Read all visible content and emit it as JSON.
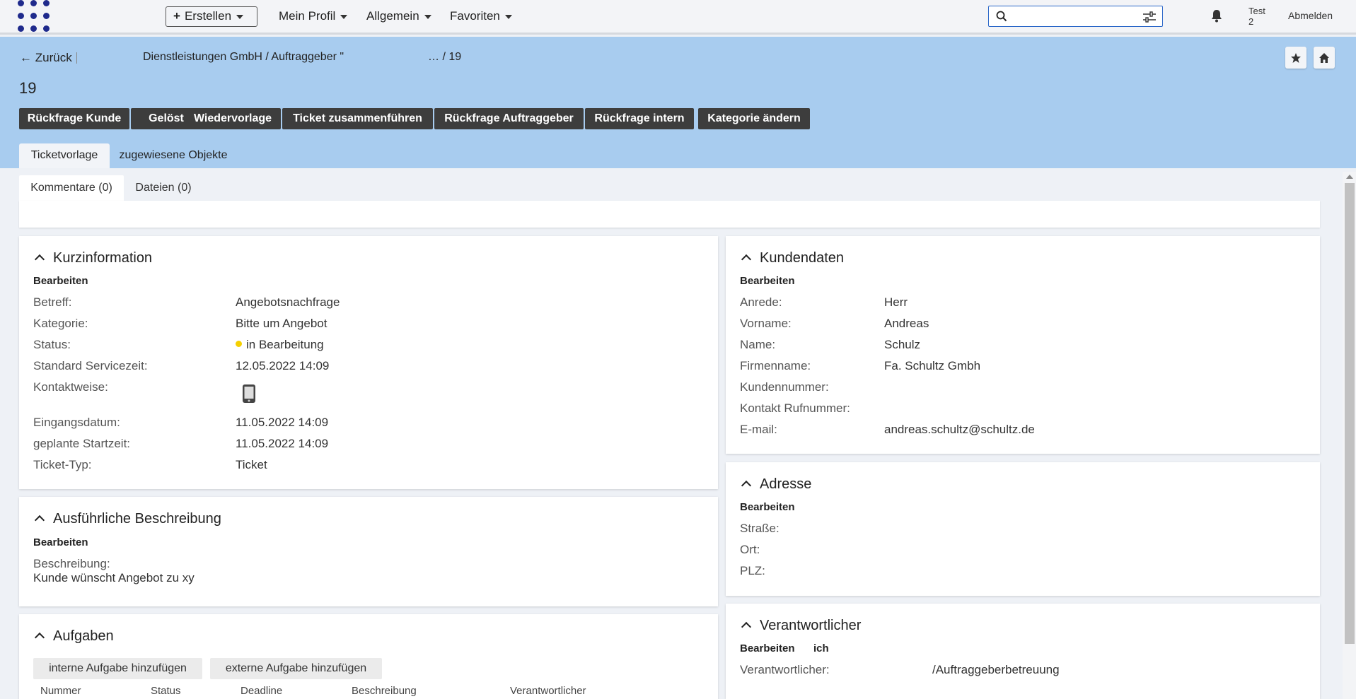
{
  "topbar": {
    "create_label": "Erstellen",
    "nav": [
      "Mein Profil",
      "Allgemein",
      "Favoriten"
    ],
    "search_placeholder": "",
    "user_line1": "Test",
    "user_line2": "2",
    "logout_label": "Abmelden"
  },
  "header": {
    "back_label": "Zurück",
    "breadcrumb": "Dienstleistungen GmbH / Auftraggeber \"",
    "breadcrumb_end": "… / 19",
    "ticket_number": "19",
    "actions": [
      "Rückfrage Kunde",
      "Gelöst",
      "Wiedervorlage",
      "Ticket zusammenführen",
      "Rückfrage Auftraggeber",
      "Rückfrage intern",
      "Kategorie ändern"
    ],
    "tabs": [
      "Ticketvorlage",
      "zugewiesene Objekte"
    ]
  },
  "subtabs": [
    "Kommentare (0)",
    "Dateien (0)"
  ],
  "kurzinfo": {
    "title": "Kurzinformation",
    "edit": "Bearbeiten",
    "rows": [
      {
        "label": "Betreff:",
        "value": "Angebotsnachfrage"
      },
      {
        "label": "Kategorie:",
        "value": "Bitte um Angebot"
      },
      {
        "label": "Status:",
        "value": "in Bearbeitung"
      },
      {
        "label": "Standard Servicezeit:",
        "value": "12.05.2022 14:09"
      },
      {
        "label": "Kontaktweise:",
        "value": ""
      },
      {
        "label": "Eingangsdatum:",
        "value": "11.05.2022 14:09"
      },
      {
        "label": "geplante Startzeit:",
        "value": "11.05.2022 14:09"
      },
      {
        "label": "Ticket-Typ:",
        "value": "Ticket"
      }
    ],
    "contact_icon": "mobile-phone-icon",
    "status_color": "#f5d000"
  },
  "beschreibung": {
    "title": "Ausführliche Beschreibung",
    "edit": "Bearbeiten",
    "label": "Beschreibung:",
    "text": "Kunde wünscht Angebot zu xy"
  },
  "aufgaben": {
    "title": "Aufgaben",
    "btn_internal": "interne Aufgabe hinzufügen",
    "btn_external": "externe Aufgabe hinzufügen",
    "columns": [
      "Nummer",
      "Status",
      "Deadline",
      "Beschreibung",
      "Verantwortlicher"
    ]
  },
  "kundendaten": {
    "title": "Kundendaten",
    "edit": "Bearbeiten",
    "rows": [
      {
        "label": "Anrede:",
        "value": "Herr"
      },
      {
        "label": "Vorname:",
        "value": "Andreas"
      },
      {
        "label": "Name:",
        "value": "Schulz"
      },
      {
        "label": "Firmenname:",
        "value": "Fa. Schultz Gmbh"
      },
      {
        "label": "Kundennummer:",
        "value": ""
      },
      {
        "label": "Kontakt Rufnummer:",
        "value": ""
      },
      {
        "label": "E-mail:",
        "value": "andreas.schultz@schultz.de"
      }
    ]
  },
  "adresse": {
    "title": "Adresse",
    "edit": "Bearbeiten",
    "rows": [
      {
        "label": "Straße:",
        "value": ""
      },
      {
        "label": "Ort:",
        "value": ""
      },
      {
        "label": "PLZ:",
        "value": ""
      }
    ]
  },
  "verantwortlicher": {
    "title": "Verantwortlicher",
    "edit": "Bearbeiten",
    "me": "ich",
    "label": "Verantwortlicher:",
    "value": "/Auftraggeberbetreuung"
  },
  "colors": {
    "header_blue": "#a8ccef",
    "action_dark": "#3d3d3d",
    "logo_navy": "#1f2a8c"
  }
}
